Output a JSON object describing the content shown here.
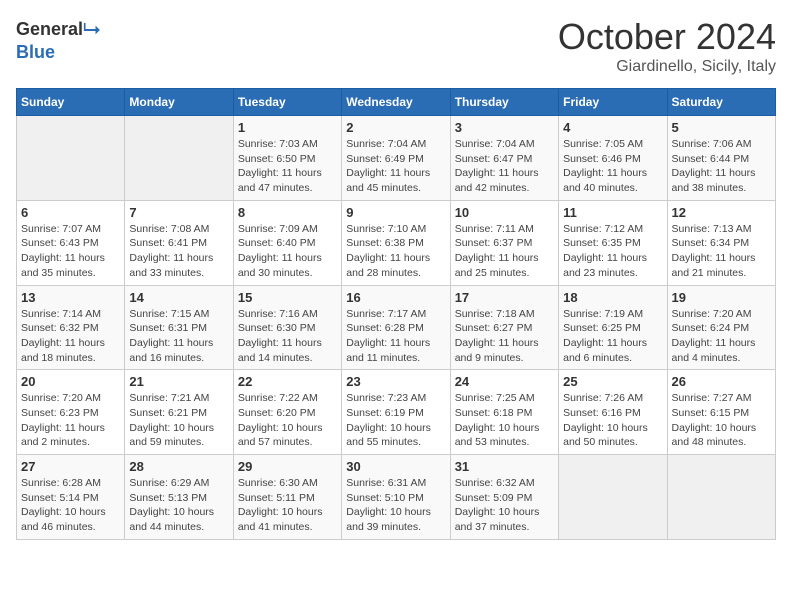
{
  "header": {
    "logo_general": "General",
    "logo_blue": "Blue",
    "month_title": "October 2024",
    "location": "Giardinello, Sicily, Italy"
  },
  "weekdays": [
    "Sunday",
    "Monday",
    "Tuesday",
    "Wednesday",
    "Thursday",
    "Friday",
    "Saturday"
  ],
  "weeks": [
    [
      {
        "day": "",
        "detail": ""
      },
      {
        "day": "",
        "detail": ""
      },
      {
        "day": "1",
        "detail": "Sunrise: 7:03 AM\nSunset: 6:50 PM\nDaylight: 11 hours and 47 minutes."
      },
      {
        "day": "2",
        "detail": "Sunrise: 7:04 AM\nSunset: 6:49 PM\nDaylight: 11 hours and 45 minutes."
      },
      {
        "day": "3",
        "detail": "Sunrise: 7:04 AM\nSunset: 6:47 PM\nDaylight: 11 hours and 42 minutes."
      },
      {
        "day": "4",
        "detail": "Sunrise: 7:05 AM\nSunset: 6:46 PM\nDaylight: 11 hours and 40 minutes."
      },
      {
        "day": "5",
        "detail": "Sunrise: 7:06 AM\nSunset: 6:44 PM\nDaylight: 11 hours and 38 minutes."
      }
    ],
    [
      {
        "day": "6",
        "detail": "Sunrise: 7:07 AM\nSunset: 6:43 PM\nDaylight: 11 hours and 35 minutes."
      },
      {
        "day": "7",
        "detail": "Sunrise: 7:08 AM\nSunset: 6:41 PM\nDaylight: 11 hours and 33 minutes."
      },
      {
        "day": "8",
        "detail": "Sunrise: 7:09 AM\nSunset: 6:40 PM\nDaylight: 11 hours and 30 minutes."
      },
      {
        "day": "9",
        "detail": "Sunrise: 7:10 AM\nSunset: 6:38 PM\nDaylight: 11 hours and 28 minutes."
      },
      {
        "day": "10",
        "detail": "Sunrise: 7:11 AM\nSunset: 6:37 PM\nDaylight: 11 hours and 25 minutes."
      },
      {
        "day": "11",
        "detail": "Sunrise: 7:12 AM\nSunset: 6:35 PM\nDaylight: 11 hours and 23 minutes."
      },
      {
        "day": "12",
        "detail": "Sunrise: 7:13 AM\nSunset: 6:34 PM\nDaylight: 11 hours and 21 minutes."
      }
    ],
    [
      {
        "day": "13",
        "detail": "Sunrise: 7:14 AM\nSunset: 6:32 PM\nDaylight: 11 hours and 18 minutes."
      },
      {
        "day": "14",
        "detail": "Sunrise: 7:15 AM\nSunset: 6:31 PM\nDaylight: 11 hours and 16 minutes."
      },
      {
        "day": "15",
        "detail": "Sunrise: 7:16 AM\nSunset: 6:30 PM\nDaylight: 11 hours and 14 minutes."
      },
      {
        "day": "16",
        "detail": "Sunrise: 7:17 AM\nSunset: 6:28 PM\nDaylight: 11 hours and 11 minutes."
      },
      {
        "day": "17",
        "detail": "Sunrise: 7:18 AM\nSunset: 6:27 PM\nDaylight: 11 hours and 9 minutes."
      },
      {
        "day": "18",
        "detail": "Sunrise: 7:19 AM\nSunset: 6:25 PM\nDaylight: 11 hours and 6 minutes."
      },
      {
        "day": "19",
        "detail": "Sunrise: 7:20 AM\nSunset: 6:24 PM\nDaylight: 11 hours and 4 minutes."
      }
    ],
    [
      {
        "day": "20",
        "detail": "Sunrise: 7:20 AM\nSunset: 6:23 PM\nDaylight: 11 hours and 2 minutes."
      },
      {
        "day": "21",
        "detail": "Sunrise: 7:21 AM\nSunset: 6:21 PM\nDaylight: 10 hours and 59 minutes."
      },
      {
        "day": "22",
        "detail": "Sunrise: 7:22 AM\nSunset: 6:20 PM\nDaylight: 10 hours and 57 minutes."
      },
      {
        "day": "23",
        "detail": "Sunrise: 7:23 AM\nSunset: 6:19 PM\nDaylight: 10 hours and 55 minutes."
      },
      {
        "day": "24",
        "detail": "Sunrise: 7:25 AM\nSunset: 6:18 PM\nDaylight: 10 hours and 53 minutes."
      },
      {
        "day": "25",
        "detail": "Sunrise: 7:26 AM\nSunset: 6:16 PM\nDaylight: 10 hours and 50 minutes."
      },
      {
        "day": "26",
        "detail": "Sunrise: 7:27 AM\nSunset: 6:15 PM\nDaylight: 10 hours and 48 minutes."
      }
    ],
    [
      {
        "day": "27",
        "detail": "Sunrise: 6:28 AM\nSunset: 5:14 PM\nDaylight: 10 hours and 46 minutes."
      },
      {
        "day": "28",
        "detail": "Sunrise: 6:29 AM\nSunset: 5:13 PM\nDaylight: 10 hours and 44 minutes."
      },
      {
        "day": "29",
        "detail": "Sunrise: 6:30 AM\nSunset: 5:11 PM\nDaylight: 10 hours and 41 minutes."
      },
      {
        "day": "30",
        "detail": "Sunrise: 6:31 AM\nSunset: 5:10 PM\nDaylight: 10 hours and 39 minutes."
      },
      {
        "day": "31",
        "detail": "Sunrise: 6:32 AM\nSunset: 5:09 PM\nDaylight: 10 hours and 37 minutes."
      },
      {
        "day": "",
        "detail": ""
      },
      {
        "day": "",
        "detail": ""
      }
    ]
  ]
}
